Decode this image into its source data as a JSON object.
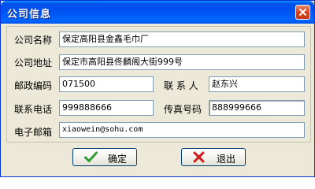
{
  "window": {
    "title": "公司信息"
  },
  "form": {
    "company_name": {
      "label": "公司名称",
      "value": "保定高阳县金鑫毛巾厂"
    },
    "company_address": {
      "label": "公司地址",
      "value": "保定市高阳县佟麟阁大街999号"
    },
    "postal_code": {
      "label": "邮政编码",
      "value": "071500"
    },
    "contact_person": {
      "label": "联 系 人",
      "value": "赵东兴"
    },
    "phone": {
      "label": "联系电话",
      "value": "999888666"
    },
    "fax": {
      "label": "传真号码",
      "value": "888999666"
    },
    "email": {
      "label": "电子邮箱",
      "value": "xiaowein@sohu.com"
    }
  },
  "buttons": {
    "ok_label": "确定",
    "exit_label": "退出"
  },
  "colors": {
    "titlebar": "#0053ee",
    "close_button": "#d9441c",
    "dialog_bg": "#ece9d8",
    "input_border": "#7f9db9",
    "ok_icon": "#2e9e2e",
    "exit_icon": "#d01c1c"
  },
  "icons": {
    "close": "close-icon",
    "ok": "checkmark-icon",
    "exit": "x-icon"
  }
}
